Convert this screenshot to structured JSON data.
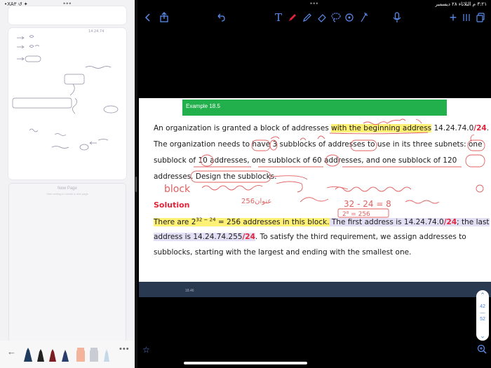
{
  "status": {
    "left": "•ΧΑ٣ ↺ ✦",
    "right": "٣:٢١ م  الثلاثاء ٢٨ ديسمبر"
  },
  "sidebar": {
    "thumbnail_date": "14.24.74",
    "new_page": {
      "title": "New Page",
      "subtitle": "Start writing to create a new page"
    }
  },
  "toolbar": {
    "text_tool_label": "T",
    "add_label": "+"
  },
  "example_title": "Example 18.5",
  "paragraphs": {
    "p1_l1_a": "An organization is granted a block of addresses ",
    "p1_l1_hl": "with the beginning address",
    "p1_l1_b": " 14.24.74.0",
    "p1_l1_prefix": "/24",
    "p1_l1_c": ".",
    "p1_l2": "The organization needs to have 3 subblocks of addresses to use in its three subnets: one",
    "p1_l3": "subblock of 10 addresses, one subblock of 60 addresses, and one subblock of 120",
    "p1_l4": "addresses. Design the subblocks."
  },
  "solution": {
    "heading": "Solution",
    "l1_a": "There are 2",
    "l1_sup": "32 − 24",
    "l1_b": " = 256 addresses in this block.",
    "l1_c": " The first address is 14.24.74.0",
    "l1_prefix": "/24",
    "l1_d": "; the last",
    "l2_a": "address is 14.24.74.255",
    "l2_prefix": "/24",
    "l2_b": ". To satisfy the third requirement, we assign addresses to",
    "l3": "subblocks, starting with the largest and ending with the smallest one."
  },
  "handwriting": {
    "block_word": "block",
    "count_note": "256عنوان",
    "calc": "32 - 24 = 8",
    "calc2": "2⁸ = 256"
  },
  "bottom_strip_number": "18.46",
  "scroll": {
    "page_current": "42",
    "page_total": "52"
  },
  "colors": {
    "accent": "#5b8def",
    "banner": "#21b04b",
    "highlight": "#fff176",
    "prefix_red": "#e0243a",
    "ink_red": "#e06060"
  }
}
